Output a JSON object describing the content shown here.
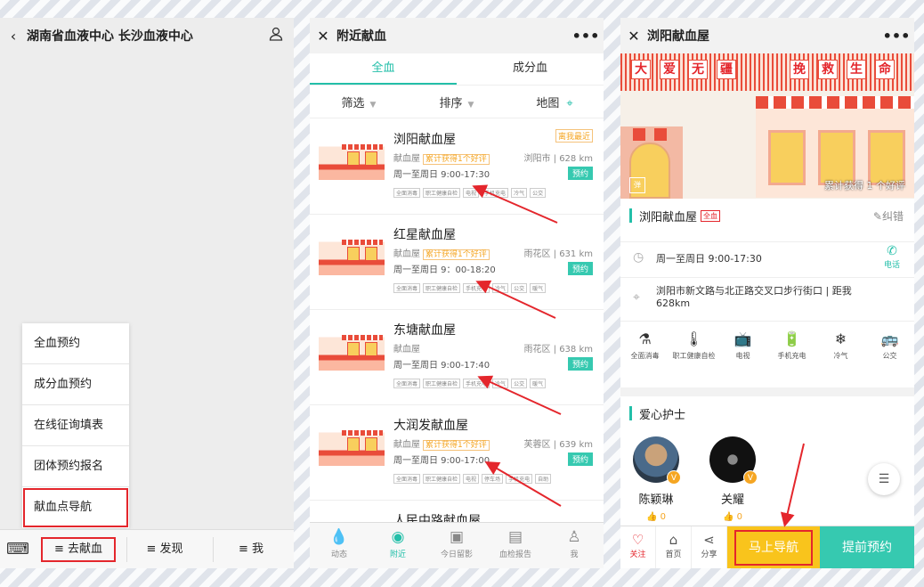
{
  "panel1": {
    "title": "湖南省血液中心 长沙血液中心",
    "menu": [
      "全血预约",
      "成分血预约",
      "在线征询填表",
      "团体预约报名",
      "献血点导航"
    ],
    "tabs": [
      "≡ 去献血",
      "≡ 发现",
      "≡ 我"
    ]
  },
  "panel2": {
    "title": "附近献血",
    "seg": [
      "全血",
      "成分血"
    ],
    "filters": [
      "筛选",
      "排序",
      "地图"
    ],
    "cards": [
      {
        "name": "浏阳献血屋",
        "type": "献血屋",
        "good": "累计获得1个好评",
        "hours": "周一至周日 9:00-17:30",
        "badge": "离我最近",
        "dist": "浏阳市 | 628 km",
        "book": "预约",
        "tags": [
          "全面消毒",
          "职工健康自检",
          "电视",
          "手机充电",
          "冷气",
          "公交"
        ]
      },
      {
        "name": "红星献血屋",
        "type": "献血屋",
        "good": "累计获得1个好评",
        "hours": "周一至周日 9：00-18:20",
        "badge": "",
        "dist": "雨花区 | 631 km",
        "book": "预约",
        "tags": [
          "全面消毒",
          "职工健康自检",
          "手机充电",
          "冷气",
          "公交",
          "暖气"
        ]
      },
      {
        "name": "东塘献血屋",
        "type": "献血屋",
        "good": "",
        "hours": "周一至周日 9:00-17:40",
        "badge": "",
        "dist": "雨花区 | 638 km",
        "book": "预约",
        "tags": [
          "全面消毒",
          "职工健康自检",
          "手机充电",
          "冷气",
          "公交",
          "暖气"
        ]
      },
      {
        "name": "大润发献血屋",
        "type": "献血屋",
        "good": "累计获得1个好评",
        "hours": "周一至周日 9:00-17:00",
        "badge": "",
        "dist": "芙蓉区 | 639 km",
        "book": "预约",
        "tags": [
          "全面消毒",
          "职工健康自检",
          "电视",
          "停车场",
          "手机充电",
          "自助"
        ]
      },
      {
        "name": "人民中路献血屋",
        "type": "",
        "good": "",
        "hours": "",
        "badge": "",
        "dist": "",
        "book": "",
        "tags": []
      }
    ],
    "nav": [
      "动态",
      "附近",
      "今日留影",
      "血检报告",
      "我"
    ]
  },
  "panel3": {
    "title": "浏阳献血屋",
    "banner_words_left": [
      "大",
      "爱",
      "无",
      "疆"
    ],
    "banner_words_right": [
      "挽",
      "救",
      "生",
      "命"
    ],
    "banner_good": "累计获得 1 个好评",
    "banner_dan": "弹",
    "name": "浏阳献血屋",
    "quan": "全血",
    "report": "纠错",
    "hours": "周一至周日 9:00-17:30",
    "phone": "电话",
    "address": "浏阳市新文路与北正路交叉口步行街口 | 距我",
    "distance": "628km",
    "facilities": [
      "全面消毒",
      "职工健康自检",
      "电视",
      "手机充电",
      "冷气",
      "公交"
    ],
    "nurse_title": "爱心护士",
    "nurses": [
      {
        "name": "陈颖琳",
        "likes": "0",
        "v": "V"
      },
      {
        "name": "关耀",
        "likes": "0",
        "v": "V"
      }
    ],
    "actions": {
      "follow": "关注",
      "home": "首页",
      "share": "分享",
      "nav": "马上导航",
      "book": "提前预约"
    }
  }
}
